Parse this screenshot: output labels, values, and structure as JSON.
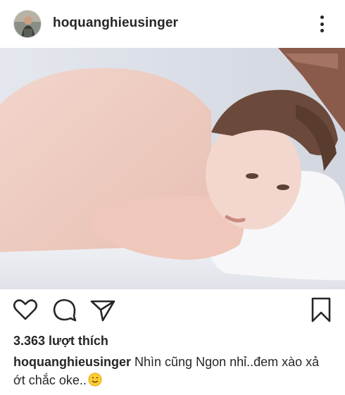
{
  "post": {
    "username": "hoquanghieusinger",
    "likes_text": "3.363 lượt thích",
    "caption_user": "hoquanghieusinger",
    "caption_text": " Nhìn cũng Ngon nhỉ..đem xào xả ớt chắc oke..",
    "emoji": "smiling-face-emoji",
    "timestamp_faded": "—"
  },
  "icons": {
    "more": "more-vertical-icon",
    "like": "heart-icon",
    "comment": "comment-icon",
    "share": "send-icon",
    "save": "bookmark-icon"
  },
  "colors": {
    "text": "#262626",
    "muted": "#8e8e8e",
    "background": "#ffffff"
  }
}
